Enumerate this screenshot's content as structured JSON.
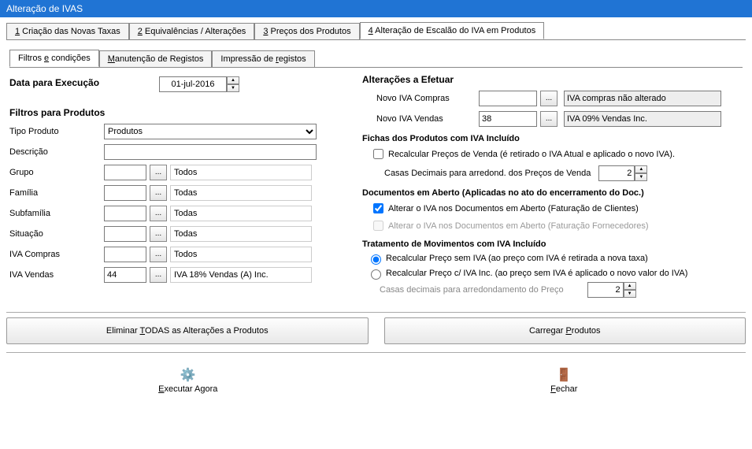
{
  "title": "Alteração de IVAS",
  "main_tabs": [
    {
      "prefix": "1",
      "label": " Criação das Novas Taxas"
    },
    {
      "prefix": "2",
      "label": " Equivalências / Alterações"
    },
    {
      "prefix": "3",
      "label": " Preços dos Produtos"
    },
    {
      "prefix": "4",
      "label": " Alteração de Escalão do IVA em Produtos"
    }
  ],
  "sub_tabs": [
    {
      "label": "Filtros e condições",
      "u": "e"
    },
    {
      "label": "Manutenção de Registos",
      "u": "M"
    },
    {
      "label": "Impressão de registos",
      "u": "r"
    }
  ],
  "left": {
    "data_execucao_label": "Data para Execução",
    "data_execucao_value": "01-jul-2016",
    "filtros_title": "Filtros para Produtos",
    "tipo_produto_label": "Tipo Produto",
    "tipo_produto_value": "Produtos",
    "descricao_label": "Descrição",
    "rows": [
      {
        "label": "Grupo",
        "code": "",
        "desc": "Todos"
      },
      {
        "label": "Família",
        "code": "",
        "desc": "Todas"
      },
      {
        "label": "Subfamília",
        "code": "",
        "desc": "Todas"
      },
      {
        "label": "Situação",
        "code": "",
        "desc": "Todas"
      },
      {
        "label": "IVA Compras",
        "code": "",
        "desc": "Todos"
      },
      {
        "label": "IVA Vendas",
        "code": "44",
        "desc": "IVA 18% Vendas (A) Inc."
      }
    ]
  },
  "right": {
    "alteracoes_title": "Alterações a Efetuar",
    "novo_iva_compras_label": "Novo IVA Compras",
    "novo_iva_compras_val": "",
    "novo_iva_compras_desc": "IVA compras não alterado",
    "novo_iva_vendas_label": "Novo IVA Vendas",
    "novo_iva_vendas_val": "38",
    "novo_iva_vendas_desc": "IVA 09% Vendas Inc.",
    "fichas_title": "Fichas dos Produtos com IVA Incluído",
    "recalcular_label": "Recalcular Preços de Venda (é retirado o IVA Atual e aplicado o novo IVA).",
    "casas_label": "Casas Decimais para arredond. dos Preços de Venda",
    "casas_val": "2",
    "docs_title": "Documentos em Aberto (Aplicadas no ato do encerramento do Doc.)",
    "alterar_clientes": "Alterar o IVA nos Documentos em Aberto (Faturação de Clientes)",
    "alterar_fornecedores": "Alterar o IVA nos Documentos em Aberto (Faturação Fornecedores)",
    "tratamento_title": "Tratamento de Movimentos com IVA Incluído",
    "radio1": "Recalcular Preço sem IVA (ao preço com IVA é retirada a nova taxa)",
    "radio2": "Recalcular Preço c/ IVA Inc. (ao preço sem IVA é aplicado o novo valor do IVA)",
    "casas2_label": "Casas decimais para arredondamento do Preço",
    "casas2_val": "2"
  },
  "buttons": {
    "eliminar": "Eliminar TODAS as Alterações a Produtos",
    "carregar": "Carregar Produtos",
    "executar": "Executar Agora",
    "fechar": "Fechar"
  }
}
